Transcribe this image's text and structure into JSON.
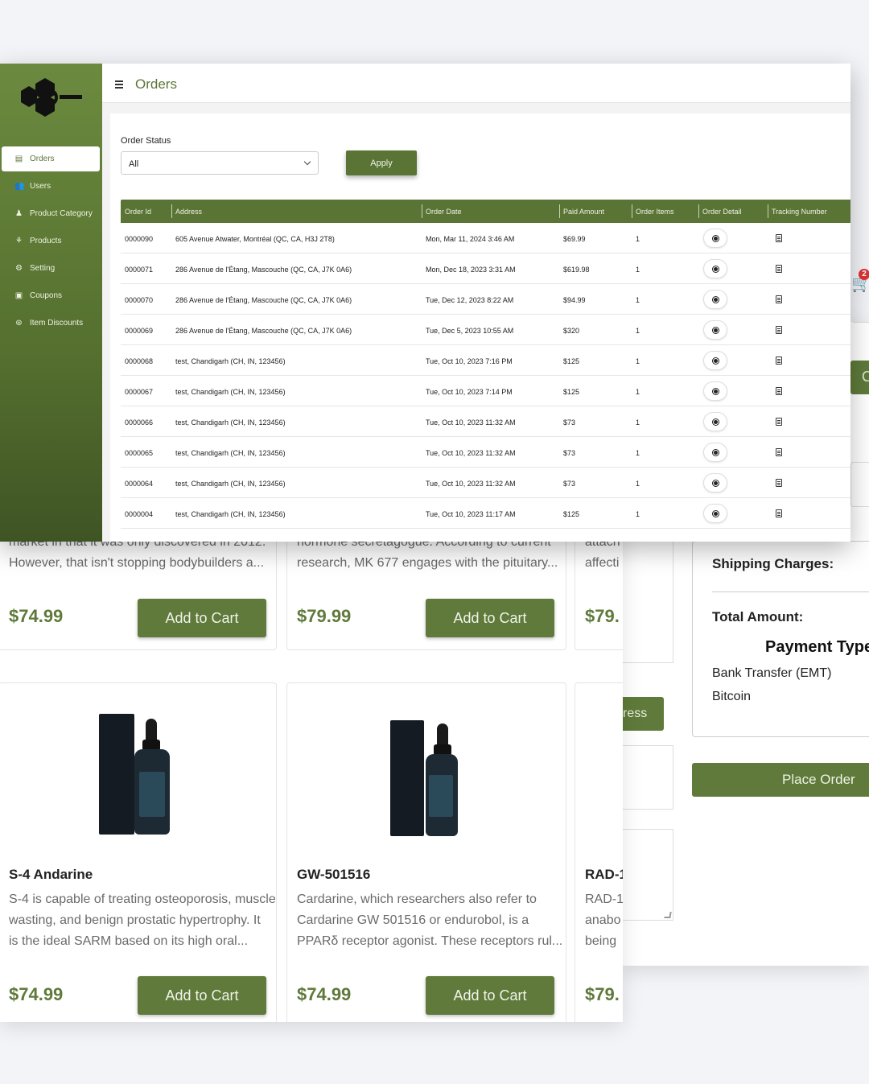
{
  "checkout": {
    "shipping_label": "Shipping Charges:",
    "total_label": "Total Amount:",
    "payment_type_title": "Payment Type",
    "payment_options": [
      "Bank Transfer (EMT)",
      "Bitcoin"
    ],
    "place_order_label": "Place Order",
    "address_button_fragment": "ress",
    "button_fragment": "C",
    "cart_count": "2"
  },
  "shop": {
    "row1": [
      {
        "desc": [
          "market in that it was only discovered in 2012.",
          "However, that isn't stopping bodybuilders a..."
        ],
        "price": "$74.99",
        "cta": "Add to Cart"
      },
      {
        "desc": [
          "hormone secretagogue. According to current",
          "research, MK 677 engages with the pituitary..."
        ],
        "price": "$79.99",
        "cta": "Add to Cart"
      },
      {
        "desc": [
          "attach",
          "affecti"
        ],
        "price": "$79.",
        "cta": ""
      }
    ],
    "row2": [
      {
        "name": "S-4 Andarine",
        "desc": [
          "S-4 is capable of treating osteoporosis, muscle",
          "wasting, and benign prostatic hypertrophy. It",
          "is the ideal SARM based on its high oral..."
        ],
        "price": "$74.99",
        "cta": "Add to Cart"
      },
      {
        "name": "GW-501516",
        "desc": [
          "Cardarine, which researchers also refer to",
          "Cardarine GW 501516 or endurobol, is a",
          "PPARδ receptor agonist. These receptors rul..."
        ],
        "price": "$74.99",
        "cta": "Add to Cart"
      },
      {
        "name": "RAD-1",
        "desc": [
          "RAD-1",
          "anabo",
          "being"
        ],
        "price": "$79.",
        "cta": ""
      }
    ]
  },
  "admin": {
    "page_title": "Orders",
    "sidebar": [
      {
        "label": "Orders",
        "icon": "clipboard-icon",
        "glyph": "▤",
        "active": true
      },
      {
        "label": "Users",
        "icon": "users-icon",
        "glyph": "👥",
        "active": false
      },
      {
        "label": "Product Category",
        "icon": "category-icon",
        "glyph": "♟",
        "active": false
      },
      {
        "label": "Products",
        "icon": "products-icon",
        "glyph": "⚘",
        "active": false
      },
      {
        "label": "Setting",
        "icon": "gear-icon",
        "glyph": "⚙",
        "active": false
      },
      {
        "label": "Coupons",
        "icon": "coupon-icon",
        "glyph": "▣",
        "active": false
      },
      {
        "label": "Item Discounts",
        "icon": "discount-icon",
        "glyph": "⊛",
        "active": false
      }
    ],
    "filter": {
      "label": "Order Status",
      "value": "All",
      "apply_label": "Apply"
    },
    "table": {
      "headers": [
        "Order Id",
        "Address",
        "Order Date",
        "Paid Amount",
        "Order Items",
        "Order Detail",
        "Tracking Number"
      ],
      "rows": [
        [
          "0000090",
          "605 Avenue Atwater, Montréal (QC, CA, H3J 2T8)",
          "Mon, Mar 11, 2024 3:46 AM",
          "$69.99",
          "1"
        ],
        [
          "0000071",
          "286 Avenue de l'Étang, Mascouche (QC, CA, J7K 0A6)",
          "Mon, Dec 18, 2023 3:31 AM",
          "$619.98",
          "1"
        ],
        [
          "0000070",
          "286 Avenue de l'Étang, Mascouche (QC, CA, J7K 0A6)",
          "Tue, Dec 12, 2023 8:22 AM",
          "$94.99",
          "1"
        ],
        [
          "0000069",
          "286 Avenue de l'Étang, Mascouche (QC, CA, J7K 0A6)",
          "Tue, Dec 5, 2023 10:55 AM",
          "$320",
          "1"
        ],
        [
          "0000068",
          "test, Chandigarh (CH, IN, 123456)",
          "Tue, Oct 10, 2023 7:16 PM",
          "$125",
          "1"
        ],
        [
          "0000067",
          "test, Chandigarh (CH, IN, 123456)",
          "Tue, Oct 10, 2023 7:14 PM",
          "$125",
          "1"
        ],
        [
          "0000066",
          "test, Chandigarh (CH, IN, 123456)",
          "Tue, Oct 10, 2023 11:32 AM",
          "$73",
          "1"
        ],
        [
          "0000065",
          "test, Chandigarh (CH, IN, 123456)",
          "Tue, Oct 10, 2023 11:32 AM",
          "$73",
          "1"
        ],
        [
          "0000064",
          "test, Chandigarh (CH, IN, 123456)",
          "Tue, Oct 10, 2023 11:32 AM",
          "$73",
          "1"
        ],
        [
          "0000004",
          "test, Chandigarh (CH, IN, 123456)",
          "Tue, Oct 10, 2023 11:17 AM",
          "$125",
          "1"
        ]
      ]
    }
  },
  "colors": {
    "brand_green": "#5a7436",
    "checkout_green": "#5f7a3a"
  }
}
